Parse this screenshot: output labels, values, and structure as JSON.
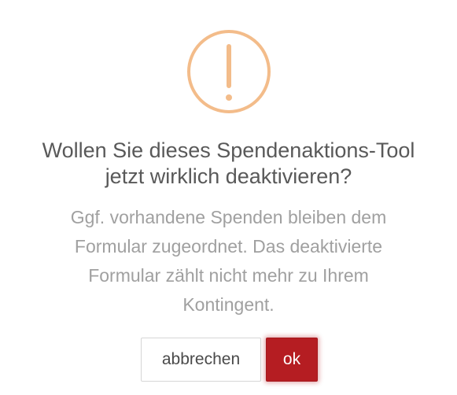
{
  "dialog": {
    "icon": "warning-exclamation-icon",
    "title_line1": "Wollen Sie dieses Spendenaktions-Tool",
    "title_line2": "jetzt wirklich deaktivieren?",
    "message_line1": "Ggf. vorhandene Spenden bleiben dem",
    "message_line2": "Formular zugeordnet. Das deaktivierte",
    "message_line3": "Formular zählt nicht mehr zu Ihrem",
    "message_line4": "Kontingent.",
    "cancel_label": "abbrechen",
    "ok_label": "ok"
  },
  "colors": {
    "icon": "#f3bc8a",
    "title": "#595959",
    "message": "#a0a0a0",
    "ok_background": "#b51d22"
  }
}
